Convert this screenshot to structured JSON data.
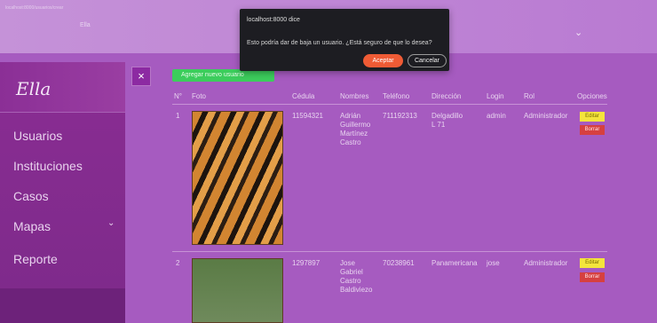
{
  "browser": {
    "tab_info": "localhost:8000/usuarios/crear",
    "tab_marker": "Ella",
    "chevron": "⌄"
  },
  "dialog": {
    "title": "localhost:8000 dice",
    "message": "Esto podría dar de baja un usuario. ¿Está seguro de que lo desea?",
    "ok_label": "Aceptar",
    "cancel_label": "Cancelar"
  },
  "sidebar": {
    "logo": "Ella",
    "items": [
      {
        "label": "Usuarios"
      },
      {
        "label": "Instituciones"
      },
      {
        "label": "Casos"
      },
      {
        "label": "Mapas"
      },
      {
        "label": "Reporte"
      }
    ]
  },
  "toolbar": {
    "close_label": "×",
    "add_label": "Agregar nuevo usuario"
  },
  "table": {
    "headers": [
      "N°",
      "Foto",
      "Cédula",
      "Nombres",
      "Teléfono",
      "Dirección",
      "Login",
      "Rol",
      "Opciones"
    ],
    "rows": [
      {
        "num": "1",
        "cedula": "11594321",
        "nombres": [
          "Adrián",
          "Guillermo",
          "Martínez",
          "Castro"
        ],
        "telefono": "711192313",
        "direccion": [
          "Delgadillo",
          "L 71"
        ],
        "login": "admin",
        "rol": "Administrador",
        "edit_label": "Editar",
        "delete_label": "Borrar"
      },
      {
        "num": "2",
        "cedula": "1297897",
        "nombres": [
          "Jose",
          "Gabriel",
          "Castro",
          "Baldiviezo"
        ],
        "telefono": "70238961",
        "direccion": [
          "Panamericana"
        ],
        "login": "jose",
        "rol": "Administrador",
        "edit_label": "Editar",
        "delete_label": "Borrar"
      }
    ]
  },
  "colors": {
    "accent": "#8a2d93",
    "add_button": "#3ccd5c",
    "edit_button": "#f4e43c",
    "delete_button": "#d64040",
    "dialog_ok": "#ef5b35"
  }
}
